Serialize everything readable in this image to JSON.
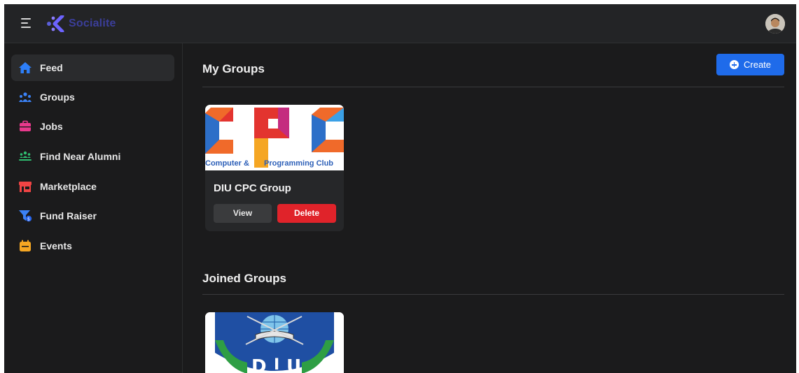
{
  "app": {
    "logo_text": "Socialite"
  },
  "sidebar": {
    "items": [
      {
        "label": "Feed",
        "icon": "home-icon",
        "active": true
      },
      {
        "label": "Groups",
        "icon": "groups-icon"
      },
      {
        "label": "Jobs",
        "icon": "briefcase-icon"
      },
      {
        "label": "Find Near Alumni",
        "icon": "alumni-icon"
      },
      {
        "label": "Marketplace",
        "icon": "store-icon"
      },
      {
        "label": "Fund Raiser",
        "icon": "fund-raiser-icon"
      },
      {
        "label": "Events",
        "icon": "calendar-icon"
      }
    ]
  },
  "main": {
    "my_groups": {
      "title": "My Groups",
      "create_label": "Create",
      "groups": [
        {
          "name": "DIU CPC Group",
          "image_text": "CPC",
          "image_caption_left": "Computer &",
          "image_caption_right": "Programming Club",
          "view_label": "View",
          "delete_label": "Delete"
        }
      ]
    },
    "joined_groups": {
      "title": "Joined Groups",
      "groups": [
        {
          "image_text": "DIU"
        }
      ]
    }
  },
  "colors": {
    "accent": "#1f6bea",
    "danger": "#e0232a",
    "logo": "#3b3e9a",
    "background": "#1b1b1c"
  }
}
